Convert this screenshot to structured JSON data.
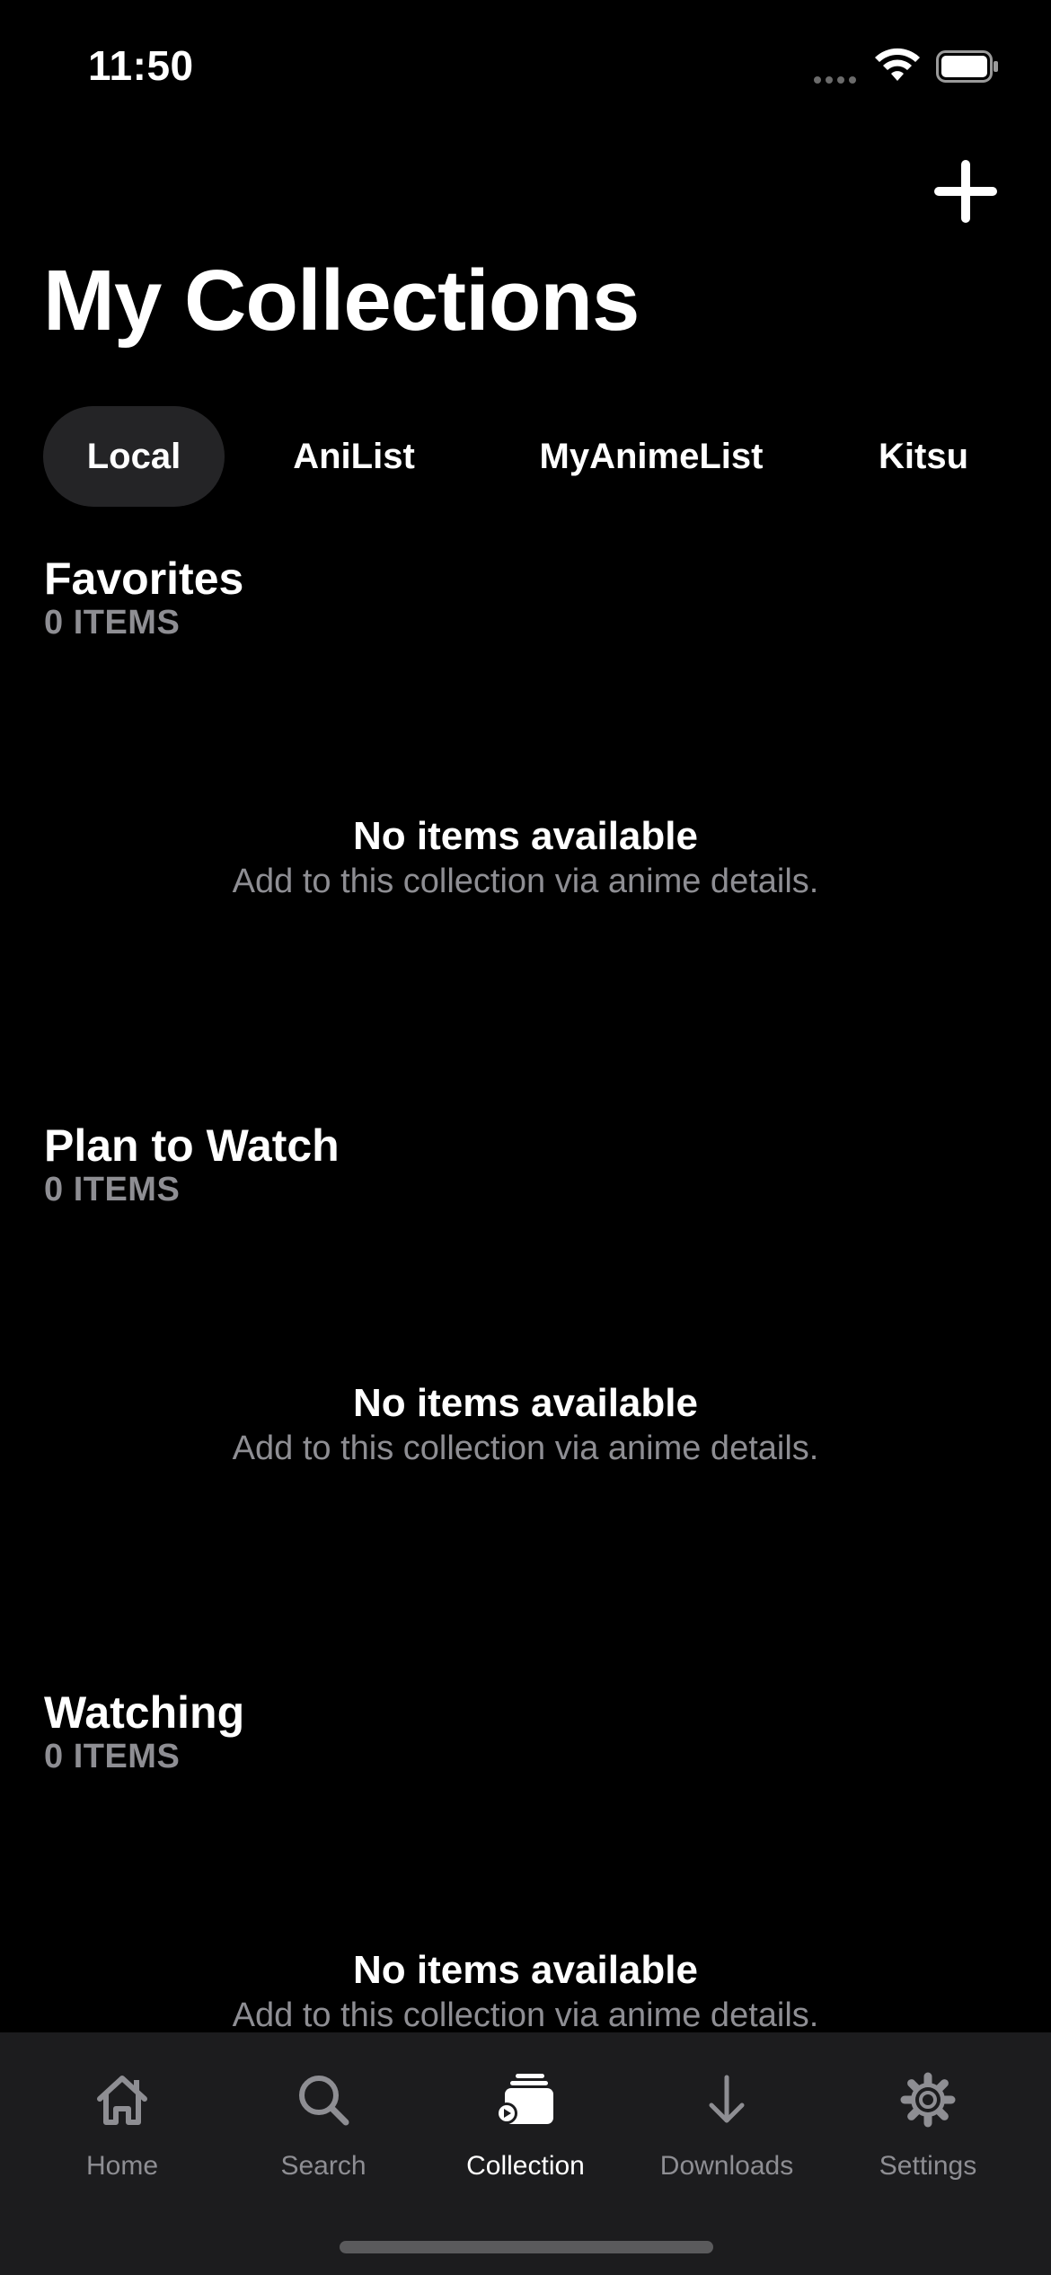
{
  "status_bar": {
    "time": "11:50"
  },
  "header": {
    "title": "My Collections",
    "add_icon": "plus-icon"
  },
  "tabs": [
    {
      "label": "Local",
      "active": true
    },
    {
      "label": "AniList",
      "active": false
    },
    {
      "label": "MyAnimeList",
      "active": false
    },
    {
      "label": "Kitsu",
      "active": false
    }
  ],
  "sections": [
    {
      "title": "Favorites",
      "count": "0 ITEMS",
      "empty_title": "No items available",
      "empty_subtitle": "Add to this collection via anime details."
    },
    {
      "title": "Plan to Watch",
      "count": "0 ITEMS",
      "empty_title": "No items available",
      "empty_subtitle": "Add to this collection via anime details."
    },
    {
      "title": "Watching",
      "count": "0 ITEMS",
      "empty_title": "No items available",
      "empty_subtitle": "Add to this collection via anime details."
    }
  ],
  "tab_bar": {
    "items": [
      {
        "label": "Home",
        "icon": "home-icon",
        "active": false
      },
      {
        "label": "Search",
        "icon": "search-icon",
        "active": false
      },
      {
        "label": "Collection",
        "icon": "collection-icon",
        "active": true
      },
      {
        "label": "Downloads",
        "icon": "download-icon",
        "active": false
      },
      {
        "label": "Settings",
        "icon": "gear-icon",
        "active": false
      }
    ]
  },
  "colors": {
    "background": "#000000",
    "secondary_text": "#8e8e93",
    "tab_active_bg": "#242426",
    "tab_bar_bg": "#1c1c1e"
  }
}
